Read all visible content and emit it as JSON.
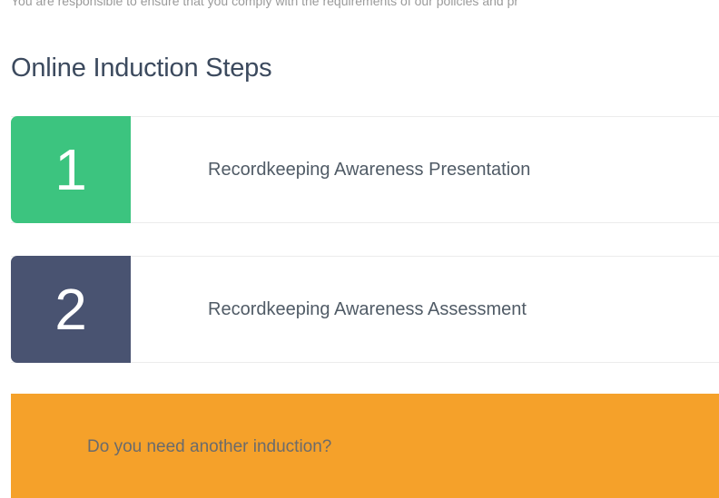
{
  "intro": {
    "text": "You are responsible to ensure that you comply with the requirements of our policies and pr"
  },
  "induction": {
    "title": "Online Induction Steps",
    "steps": [
      {
        "number": "1",
        "label": "Recordkeeping Awareness Presentation",
        "color": "#3cc47f"
      },
      {
        "number": "2",
        "label": "Recordkeeping Awareness Assessment",
        "color": "#495371"
      }
    ]
  },
  "cta": {
    "text": "Do you need another induction?",
    "color": "#f5a12a"
  }
}
